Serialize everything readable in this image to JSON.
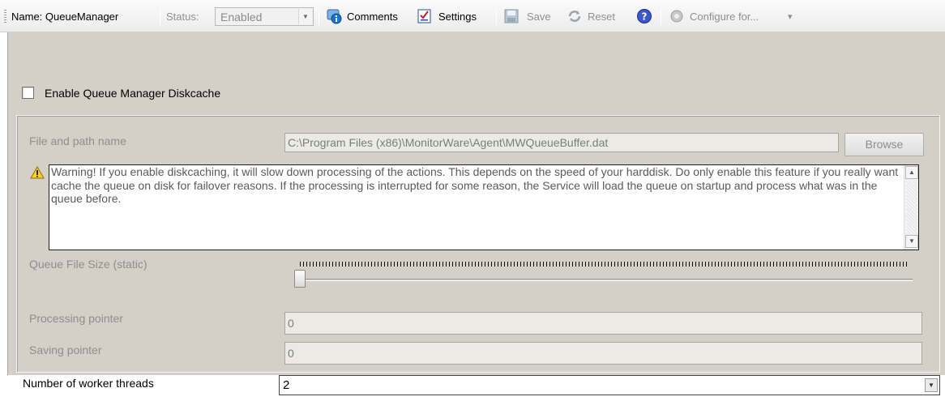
{
  "toolbar": {
    "name_label": "Name: QueueManager",
    "status_label": "Status:",
    "status_value": "Enabled",
    "comments": "Comments",
    "settings": "Settings",
    "save": "Save",
    "reset": "Reset",
    "configure": "Configure for...",
    "configure_arrow": "▾"
  },
  "diskcache": {
    "checkbox_label": "Enable Queue Manager Diskcache",
    "checked": false
  },
  "file": {
    "label": "File and path name",
    "value": "C:\\Program Files (x86)\\MonitorWare\\Agent\\MWQueueBuffer.dat",
    "browse": "Browse"
  },
  "warning": {
    "text": "Warning! If you enable diskcaching, it will slow down processing of the actions. This depends on the speed of your harddisk. Do only enable this feature if you really want cache the queue on disk for failover reasons. If the processing is interrupted for some reason, the Service will load the queue on startup and process what was in the queue before."
  },
  "queue_size": {
    "label": "Queue File Size (static)",
    "slider_level": 0
  },
  "processing_pointer": {
    "label": "Processing pointer",
    "value": "0"
  },
  "saving_pointer": {
    "label": "Saving pointer",
    "value": "0"
  },
  "worker_threads": {
    "label": "Number of worker threads",
    "value": "2"
  }
}
